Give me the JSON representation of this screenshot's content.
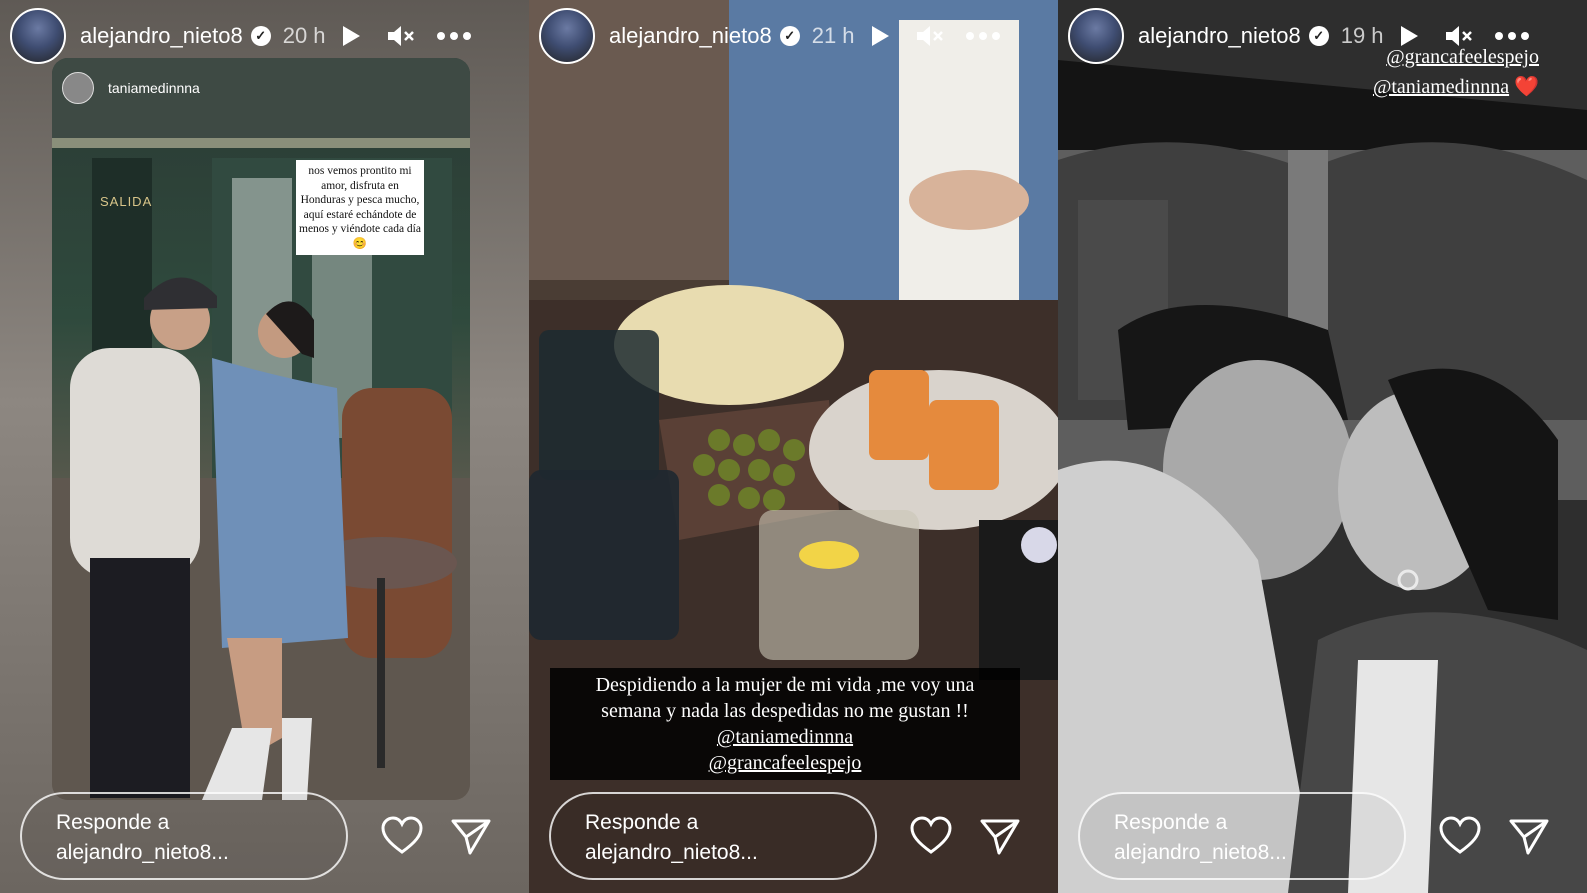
{
  "stories": [
    {
      "username": "alejandro_nieto8",
      "time": "20 h",
      "reply_placeholder_line1": "Responde a",
      "reply_placeholder_line2": "alejandro_nieto8...",
      "mention": "taniamedinnna",
      "note": "nos vemos prontito mi amor, disfruta en Honduras y pesca mucho, aquí estaré echándote de menos y viéndote cada día 😊",
      "sign": "SALIDA"
    },
    {
      "username": "alejandro_nieto8",
      "time": "21 h",
      "reply_placeholder_line1": "Responde a",
      "reply_placeholder_line2": "alejandro_nieto8...",
      "caption_line1": "Despidiendo a la mujer de mi vida ,me voy una",
      "caption_line2": "semana y nada las despedidas no me gustan !!",
      "caption_tag1": "@taniamedinnna",
      "caption_tag2": "@grancafeelespejo"
    },
    {
      "username": "alejandro_nieto8",
      "time": "19 h",
      "reply_placeholder_line1": "Responde a",
      "reply_placeholder_line2": "alejandro_nieto8...",
      "tag1": "@grancafeelespejo",
      "tag2": "@taniamedinnna",
      "tag2_emoji": "❤️"
    }
  ],
  "icons": {
    "verified": "✓",
    "play": "play-icon",
    "mute": "mute-icon",
    "more": "more-icon",
    "heart": "heart-icon",
    "send": "send-icon"
  },
  "colors": {
    "text": "#ffffff",
    "heart_emoji": "#e0334a"
  }
}
